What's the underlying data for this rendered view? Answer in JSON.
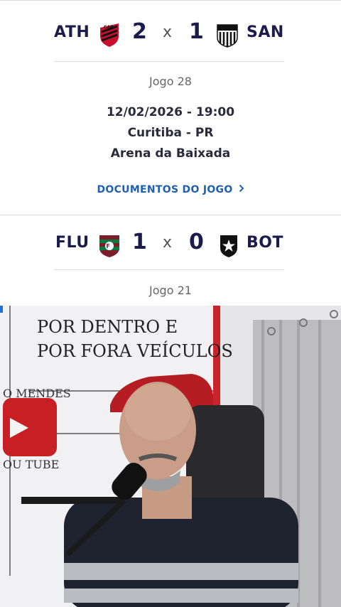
{
  "matches": [
    {
      "home_abbr": "ATH",
      "home_score": "2",
      "separator": "x",
      "away_score": "1",
      "away_abbr": "SAN",
      "home_crest": "athletico-crest-icon",
      "away_crest": "santos-crest-icon",
      "game_label": "Jogo 28",
      "datetime": "12/02/2026 - 19:00",
      "city": "Curitiba - PR",
      "stadium": "Arena da Baixada",
      "documents_link": "DOCUMENTOS DO JOGO"
    },
    {
      "home_abbr": "FLU",
      "home_score": "1",
      "separator": "x",
      "away_score": "0",
      "away_abbr": "BOT",
      "home_crest": "fluminense-crest-icon",
      "away_crest": "botafogo-crest-icon",
      "game_label": "Jogo 21"
    }
  ],
  "video_overlay": {
    "banner_line_1": "POR DENTRO E",
    "banner_line_2": "POR FORA VEÍCULOS",
    "side_text_1": "O MENDES",
    "side_text_2": "OU TUBE"
  },
  "colors": {
    "team_text": "#1c1b4d",
    "link": "#1f5fb4",
    "divider": "#dcdce2"
  }
}
